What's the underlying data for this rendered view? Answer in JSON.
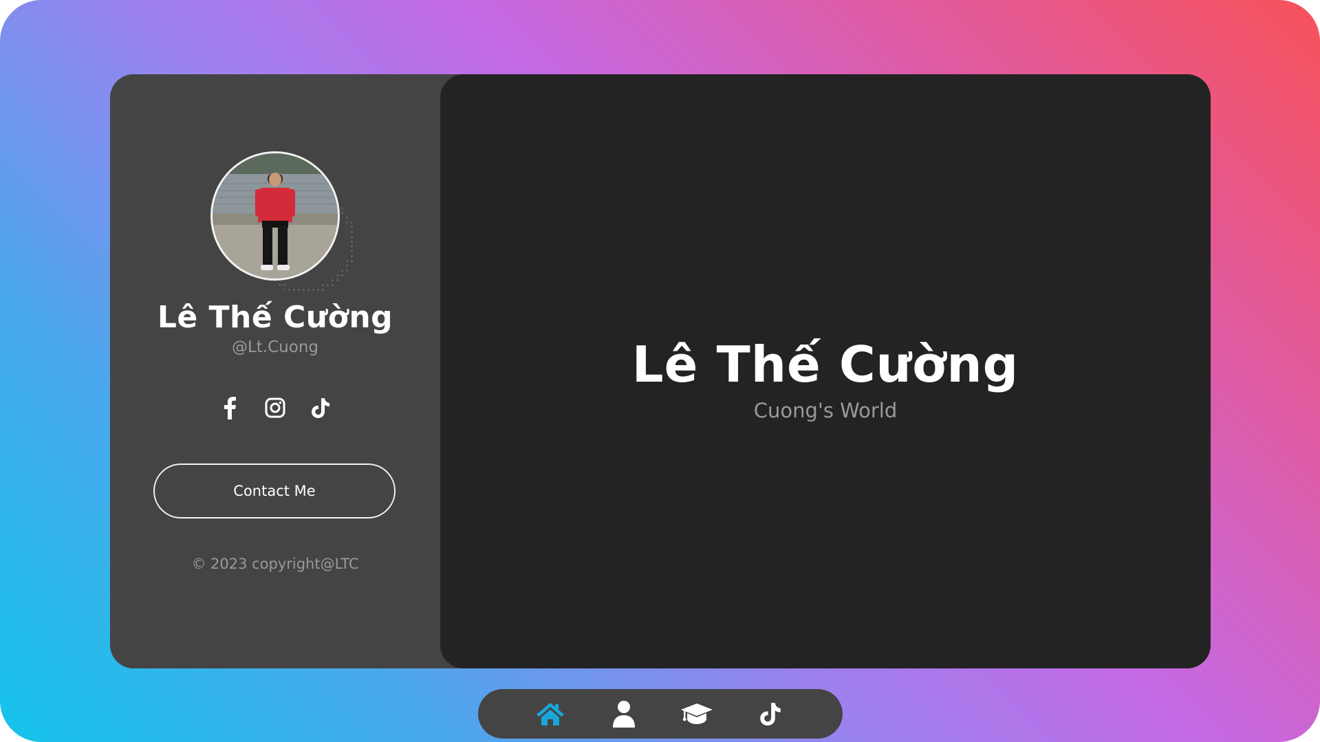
{
  "profile": {
    "name": "Lê Thế Cường",
    "handle": "@Lt.Cuong"
  },
  "socials": [
    {
      "icon": "facebook-icon"
    },
    {
      "icon": "instagram-icon"
    },
    {
      "icon": "tiktok-icon"
    }
  ],
  "contact": {
    "label": "Contact Me"
  },
  "footer": {
    "copyright": "© 2023 copyright@LTC"
  },
  "main": {
    "title": "Lê Thế Cường",
    "subtitle": "Cuong's World"
  },
  "nav": {
    "items": [
      {
        "icon": "home-icon",
        "active": true
      },
      {
        "icon": "user-icon",
        "active": false
      },
      {
        "icon": "graduation-cap-icon",
        "active": false
      },
      {
        "icon": "tiktok-icon",
        "active": false
      }
    ],
    "active_color": "#1aa6d9",
    "icon_color": "#ffffff"
  },
  "colors": {
    "sidebar_bg": "#444444",
    "main_bg": "#232323",
    "gradient": [
      "#14c4ea",
      "#9b82ee",
      "#c46ae6",
      "#f7525a"
    ]
  }
}
